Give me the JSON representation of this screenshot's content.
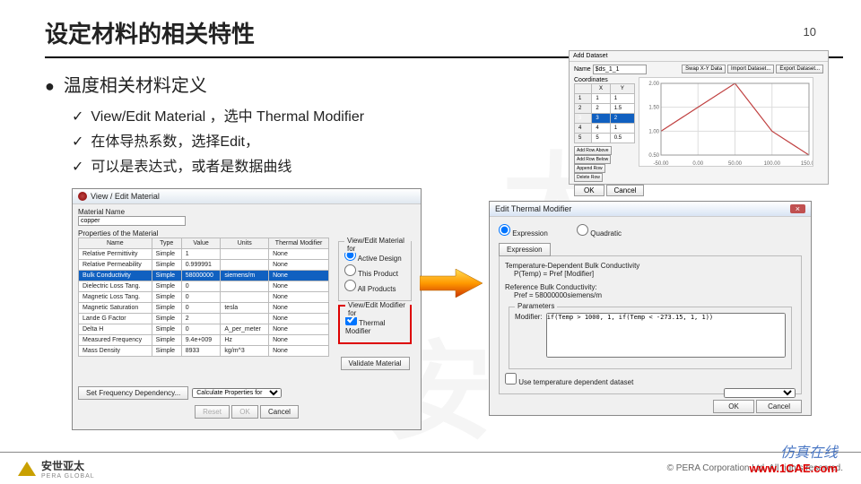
{
  "page": {
    "title": "设定材料的相关特性",
    "number": "10"
  },
  "bullets": {
    "main": "温度相关材料定义",
    "s1": "View/Edit Material ，选中 Thermal Modifier",
    "s2": "在体导热系数，选择Edit，",
    "s3": "可以是表达式，或者是数据曲线"
  },
  "dlg1": {
    "title": "View / Edit Material",
    "matname_label": "Material Name",
    "matname": "copper",
    "props_label": "Properties of the Material",
    "headers": {
      "name": "Name",
      "type": "Type",
      "value": "Value",
      "units": "Units",
      "thermal": "Thermal Modifier"
    },
    "rows": [
      {
        "n": "Relative Permittivity",
        "t": "Simple",
        "v": "1",
        "u": "",
        "m": "None"
      },
      {
        "n": "Relative Permeability",
        "t": "Simple",
        "v": "0.999991",
        "u": "",
        "m": "None"
      },
      {
        "n": "Bulk Conductivity",
        "t": "Simple",
        "v": "58000000",
        "u": "siemens/m",
        "m": "None",
        "sel": true
      },
      {
        "n": "Dielectric Loss Tang.",
        "t": "Simple",
        "v": "0",
        "u": "",
        "m": "None"
      },
      {
        "n": "Magnetic Loss Tang.",
        "t": "Simple",
        "v": "0",
        "u": "",
        "m": "None"
      },
      {
        "n": "Magnetic Saturation",
        "t": "Simple",
        "v": "0",
        "u": "tesla",
        "m": "None"
      },
      {
        "n": "Lande G Factor",
        "t": "Simple",
        "v": "2",
        "u": "",
        "m": "None"
      },
      {
        "n": "Delta H",
        "t": "Simple",
        "v": "0",
        "u": "A_per_meter",
        "m": "None"
      },
      {
        "n": "Measured Frequency",
        "t": "Simple",
        "v": "9.4e+009",
        "u": "Hz",
        "m": "None"
      },
      {
        "n": "Mass Density",
        "t": "Simple",
        "v": "8933",
        "u": "kg/m^3",
        "m": "None"
      }
    ],
    "viewedit_group": "View/Edit Material for",
    "r1": "Active Design",
    "r2": "This Product",
    "r3": "All Products",
    "modifier_group": "View/Edit Modifier for",
    "c1": "Thermal Modifier",
    "validate": "Validate Material",
    "setfreq": "Set Frequency Dependency...",
    "calc": "Calculate Properties for",
    "reset": "Reset",
    "ok": "OK",
    "cancel": "Cancel"
  },
  "dlg2": {
    "title": "Edit Thermal Modifier",
    "r_expr": "Expression",
    "r_quad": "Quadratic",
    "expr_btn": "Expression",
    "l1": "Temperature-Dependent Bulk Conductivity",
    "l1f": "P(Temp) = Pref [Modifier]",
    "l2": "Reference Bulk Conductivity:",
    "l2f": "Pref = 58000000siemens/m",
    "params": "Parameters",
    "mod_label": "Modifier:",
    "mod_val": "if(Temp > 1000, 1, if(Temp < -273.15, 1, 1))",
    "use_ds": "Use temperature dependent dataset",
    "ok": "OK",
    "cancel": "Cancel"
  },
  "dlg3": {
    "title": "Add Dataset",
    "name_lbl": "Name",
    "name_val": "$ds_1_1",
    "coords": "Coordinates",
    "btn_swap": "Swap X-Y Data",
    "btn_imp": "Import Dataset...",
    "btn_exp": "Export Dataset...",
    "btn_addabove": "Add Row Above",
    "btn_addbelow": "Add Row Below",
    "btn_append": "Append Row",
    "btn_del": "Delete Row",
    "ok": "OK",
    "cancel": "Cancel",
    "tbl": {
      "hX": "X",
      "hY": "Y",
      "rows": [
        [
          "1",
          "1"
        ],
        [
          "2",
          "1.5"
        ],
        [
          "3",
          "2"
        ],
        [
          "4",
          "1"
        ],
        [
          "5",
          "0.5"
        ]
      ]
    }
  },
  "chart_data": {
    "type": "line",
    "x": [
      -50,
      0,
      50,
      100,
      150
    ],
    "y": [
      1.0,
      1.5,
      2.0,
      1.0,
      0.5
    ],
    "xlabel": "",
    "ylabel": "",
    "xlim": [
      -50,
      150
    ],
    "ylim": [
      0.5,
      2.0
    ],
    "xticks": [
      -50,
      0,
      50,
      100,
      150
    ],
    "yticks": [
      0.5,
      1.0,
      1.5,
      2.0
    ]
  },
  "footer": {
    "brand_cn": "安世亚太",
    "brand_en": "PERA GLOBAL",
    "copyright": "© PERA Corporation Ltd. All rights reserved.",
    "wm1": "仿真在线",
    "wm2": "www.1CAE.com"
  }
}
